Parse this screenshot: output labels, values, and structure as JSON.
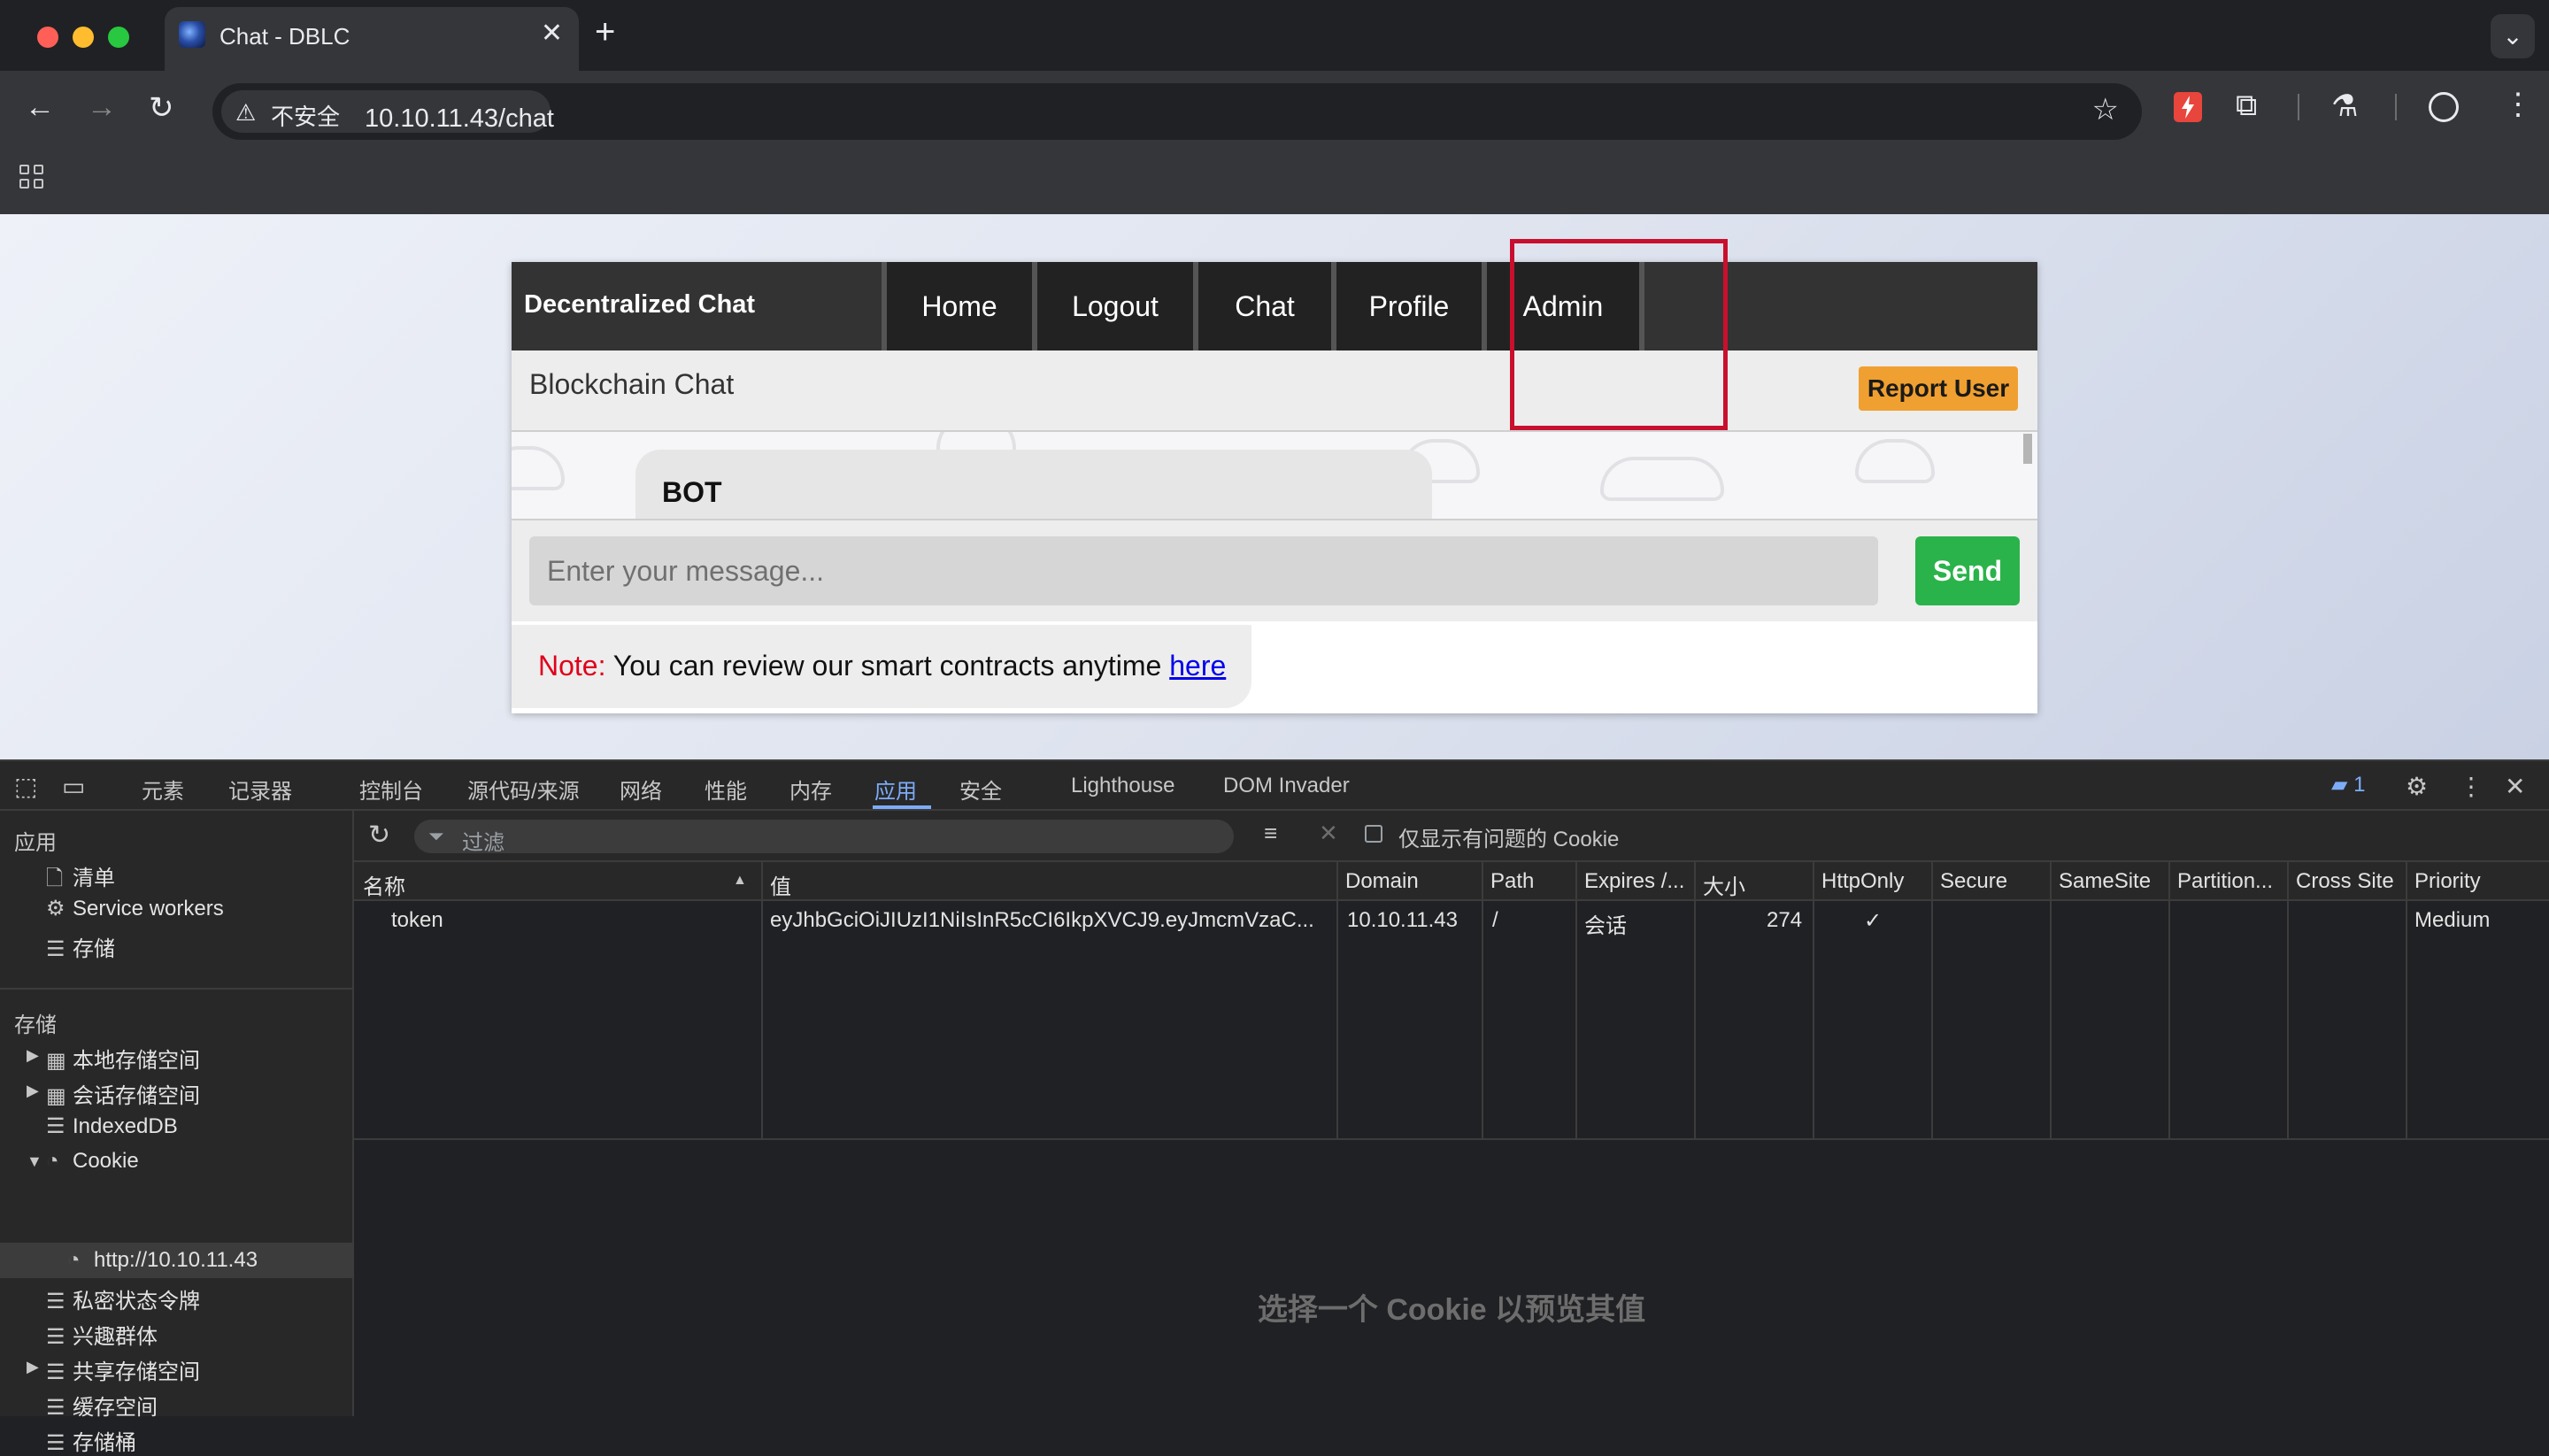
{
  "browser": {
    "tab_title": "Chat - DBLC",
    "tab_close": "✕",
    "new_tab": "+",
    "tab_search": "⌄",
    "security_label": "不安全",
    "url": "10.10.11.43/chat"
  },
  "app": {
    "brand": "Decentralized Chat",
    "nav": [
      "Home",
      "Logout",
      "Chat",
      "Profile",
      "Admin"
    ],
    "chat_title": "Blockchain Chat",
    "report_button": "Report User",
    "bot_name": "BOT",
    "message_placeholder": "Enter your message...",
    "send_button": "Send",
    "note_label": "Note:",
    "note_text": " You can review our smart contracts anytime ",
    "note_link": "here"
  },
  "devtools": {
    "tabs": [
      "元素",
      "记录器",
      "控制台",
      "源代码/来源",
      "网络",
      "性能",
      "内存",
      "应用",
      "安全",
      "Lighthouse",
      "DOM Invader"
    ],
    "issues_count": "1",
    "sidebar": {
      "app_heading": "应用",
      "app_items": [
        "清单",
        "Service workers",
        "存储"
      ],
      "storage_heading": "存储",
      "storage_items": [
        "本地存储空间",
        "会话存储空间",
        "IndexedDB",
        "Cookie",
        "http://10.10.11.43",
        "私密状态令牌",
        "兴趣群体",
        "共享存储空间",
        "缓存空间",
        "存储桶"
      ]
    },
    "filter_placeholder": "过滤",
    "only_issues_label": "仅显示有问题的 Cookie",
    "columns": [
      "名称",
      "值",
      "Domain",
      "Path",
      "Expires /...",
      "大小",
      "HttpOnly",
      "Secure",
      "SameSite",
      "Partition...",
      "Cross Site",
      "Priority"
    ],
    "rows": [
      {
        "name": "token",
        "value": "eyJhbGciOiJIUzI1NiIsInR5cCI6IkpXVCJ9.eyJmcmVzaC...",
        "domain": "10.10.11.43",
        "path": "/",
        "expires": "会话",
        "size": "274",
        "httponly": "✓",
        "priority": "Medium"
      }
    ],
    "preview_message": "选择一个 Cookie 以预览其值"
  }
}
